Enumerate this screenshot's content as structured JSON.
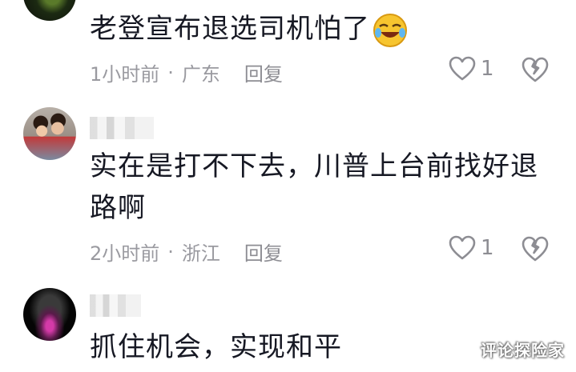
{
  "comments": [
    {
      "text": "老登宣布退选司机怕了",
      "emoji": "rofl-emoji",
      "time": "1小时前",
      "location": "广东",
      "reply_label": "回复",
      "likes": "1"
    },
    {
      "text": "实在是打不下去，川普上台前找好退路啊",
      "time": "2小时前",
      "location": "浙江",
      "reply_label": "回复",
      "likes": "1"
    },
    {
      "text": "抓住机会，实现和平"
    }
  ],
  "separator": "·",
  "watermark": "评论探险家",
  "colors": {
    "text": "#161823",
    "meta": "#9a9aa0",
    "background": "#ffffff"
  }
}
